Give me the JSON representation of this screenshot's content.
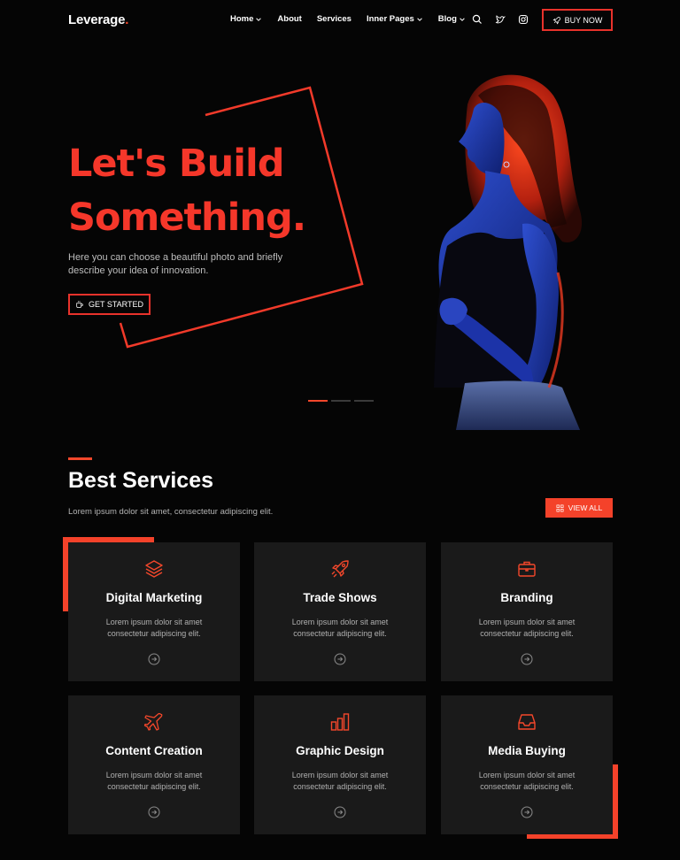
{
  "nav": {
    "logo": "Leverage",
    "logo_dot": ".",
    "menu": [
      {
        "label": "Home",
        "dropdown": true
      },
      {
        "label": "About",
        "dropdown": false
      },
      {
        "label": "Services",
        "dropdown": false
      },
      {
        "label": "Inner Pages",
        "dropdown": true
      },
      {
        "label": "Blog",
        "dropdown": true
      }
    ],
    "icons": [
      "search-icon",
      "twitter-icon",
      "instagram-icon"
    ],
    "buy_label": "BUY NOW"
  },
  "hero": {
    "title_line1": "Let's Build",
    "title_line2": "Something.",
    "description": "Here you can choose a beautiful photo and briefly describe your idea of innovation.",
    "cta_label": "GET STARTED",
    "slides": 3,
    "active_slide": 1
  },
  "services": {
    "title": "Best Services",
    "subtitle": "Lorem ipsum dolor sit amet, consectetur adipiscing elit.",
    "view_all_label": "VIEW ALL",
    "cards": [
      {
        "title": "Digital Marketing",
        "desc": "Lorem ipsum dolor sit amet consectetur adipiscing elit.",
        "icon": "layers-icon"
      },
      {
        "title": "Trade Shows",
        "desc": "Lorem ipsum dolor sit amet consectetur adipiscing elit.",
        "icon": "rocket-icon"
      },
      {
        "title": "Branding",
        "desc": "Lorem ipsum dolor sit amet consectetur adipiscing elit.",
        "icon": "briefcase-icon"
      },
      {
        "title": "Content Creation",
        "desc": "Lorem ipsum dolor sit amet consectetur adipiscing elit.",
        "icon": "airplane-icon"
      },
      {
        "title": "Graphic Design",
        "desc": "Lorem ipsum dolor sit amet consectetur adipiscing elit.",
        "icon": "bar-chart-icon"
      },
      {
        "title": "Media Buying",
        "desc": "Lorem ipsum dolor sit amet consectetur adipiscing elit.",
        "icon": "inbox-icon"
      }
    ]
  },
  "colors": {
    "accent": "#f3472b",
    "background": "#050505",
    "card": "#1a1a1a"
  }
}
